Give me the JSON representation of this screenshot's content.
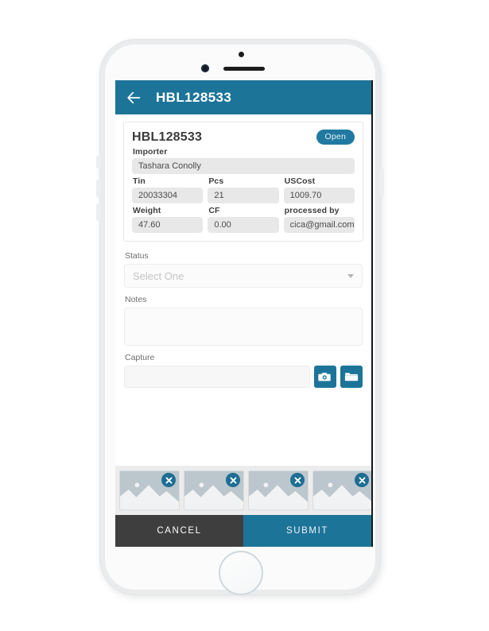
{
  "device": {
    "type": "smartphone",
    "sensor": "proximity-sensor",
    "camera": "front-camera",
    "speaker": "earpiece-speaker",
    "home": "home-button"
  },
  "appbar": {
    "back_icon": "back-arrow-icon",
    "title": "HBL128533",
    "background": "#1d7499"
  },
  "detail_card": {
    "title": "HBL128533",
    "status_badge": {
      "label": "Open",
      "color": "#2079a0"
    },
    "fields": [
      {
        "label": "Importer",
        "value": "Tashara Conolly"
      }
    ],
    "row_one": [
      {
        "label": "Tin",
        "value": "20033304"
      },
      {
        "label": "Pcs",
        "value": "21"
      },
      {
        "label": "USCost",
        "value": "1009.70"
      }
    ],
    "row_two": [
      {
        "label": "Weight",
        "value": "47.60"
      },
      {
        "label": "CF",
        "value": "0.00"
      },
      {
        "label": "processed by",
        "value": "cica@gmail.com"
      }
    ]
  },
  "form": {
    "status": {
      "label": "Status",
      "placeholder": "Select One",
      "value": "",
      "caret_icon": "chevron-down-icon"
    },
    "notes": {
      "label": "Notes",
      "value": "",
      "placeholder": ""
    },
    "capture": {
      "label": "Capture",
      "value": "",
      "placeholder": "",
      "camera_icon": "camera-icon",
      "folder_icon": "folder-icon"
    }
  },
  "thumbnails": {
    "remove_icon": "close-circle-icon",
    "placeholder_icon": "image-placeholder-icon",
    "items": [
      {
        "name": "attachment-1"
      },
      {
        "name": "attachment-2"
      },
      {
        "name": "attachment-3"
      },
      {
        "name": "attachment-4"
      }
    ]
  },
  "footer": {
    "cancel_label": "CANCEL",
    "submit_label": "SUBMIT",
    "cancel_color": "#3e3e3e",
    "submit_color": "#1d7499"
  }
}
